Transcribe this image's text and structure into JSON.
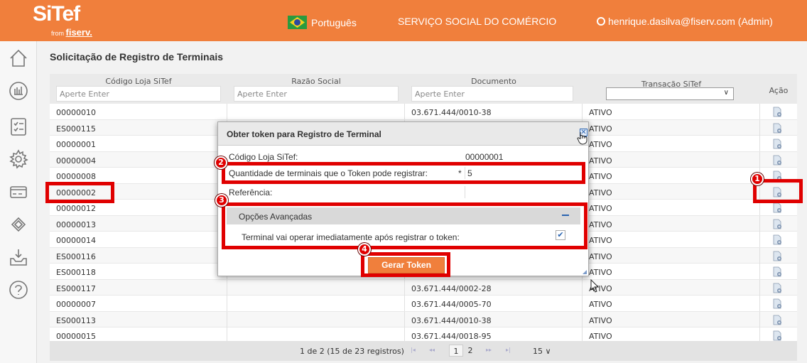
{
  "header": {
    "brand": "SiTef",
    "brand_from": "from",
    "brand_company": "fiserv.",
    "language": "Português",
    "company": "SERVIÇO SOCIAL DO COMÉRCIO",
    "user": "henrique.dasilva@fiserv.com (Admin)",
    "accent_color": "#f07f3c"
  },
  "sidebar": {
    "icons": [
      "home-icon",
      "chart-icon",
      "checklist-icon",
      "gear-icon",
      "card-icon",
      "diamond-icon",
      "inbox-download-icon",
      "help-icon"
    ]
  },
  "page": {
    "title": "Solicitação de Registro de Terminais"
  },
  "grid": {
    "columns": [
      {
        "label": "Código Loja SiTef",
        "placeholder": "Aperte Enter"
      },
      {
        "label": "Razão Social",
        "placeholder": "Aperte Enter"
      },
      {
        "label": "Documento",
        "placeholder": "Aperte Enter"
      },
      {
        "label": "Transação SiTef",
        "select": ""
      },
      {
        "label": "Ação"
      }
    ],
    "rows": [
      {
        "code": "00000010",
        "doc": "03.671.444/0010-38",
        "status": "ATIVO"
      },
      {
        "code": "ES000115",
        "doc": "",
        "status": "ATIVO"
      },
      {
        "code": "00000001",
        "doc": "",
        "status": "ATIVO"
      },
      {
        "code": "00000004",
        "doc": "",
        "status": "ATIVO"
      },
      {
        "code": "00000008",
        "doc": "",
        "status": "ATIVO"
      },
      {
        "code": "00000002",
        "doc": "",
        "status": "ATIVO"
      },
      {
        "code": "00000012",
        "doc": "",
        "status": "ATIVO"
      },
      {
        "code": "00000013",
        "doc": "",
        "status": "ATIVO"
      },
      {
        "code": "00000014",
        "doc": "",
        "status": "ATIVO"
      },
      {
        "code": "ES000116",
        "doc": "",
        "status": "ATIVO"
      },
      {
        "code": "ES000118",
        "doc": "",
        "status": "ATIVO"
      },
      {
        "code": "ES000117",
        "doc": "03.671.444/0002-28",
        "status": "ATIVO"
      },
      {
        "code": "00000007",
        "doc": "03.671.444/0005-70",
        "status": "ATIVO"
      },
      {
        "code": "ES000113",
        "doc": "03.671.444/0010-38",
        "status": "ATIVO"
      },
      {
        "code": "00000015",
        "doc": "03.671.444/0018-95",
        "status": "ATIVO"
      }
    ]
  },
  "pager": {
    "summary": "1 de 2 (15 de 23 registros)",
    "first": "|◂",
    "prev": "◂◂",
    "pages": [
      "1",
      "2"
    ],
    "next": "▸▸",
    "last": "▸|",
    "page_size": "15 ∨"
  },
  "dialog": {
    "title": "Obter token para Registro de Terminal",
    "close": "✕",
    "store_code_label": "Código Loja SiTef:",
    "store_code_value": "00000001",
    "qty_label": "Quantidade de terminais que o Token pode registrar:",
    "qty_required": "*",
    "qty_value": "5",
    "ref_label": "Referência:",
    "ref_value": "",
    "advanced_title": "Opções Avançadas",
    "advanced_option": "Terminal vai operar imediatamente após registrar o token:",
    "advanced_checked": true,
    "check_mark": "✔",
    "generate_button": "Gerar Token"
  },
  "annotations": {
    "badges": [
      "1",
      "2",
      "3",
      "4"
    ],
    "highlight_color": "#e00000"
  }
}
